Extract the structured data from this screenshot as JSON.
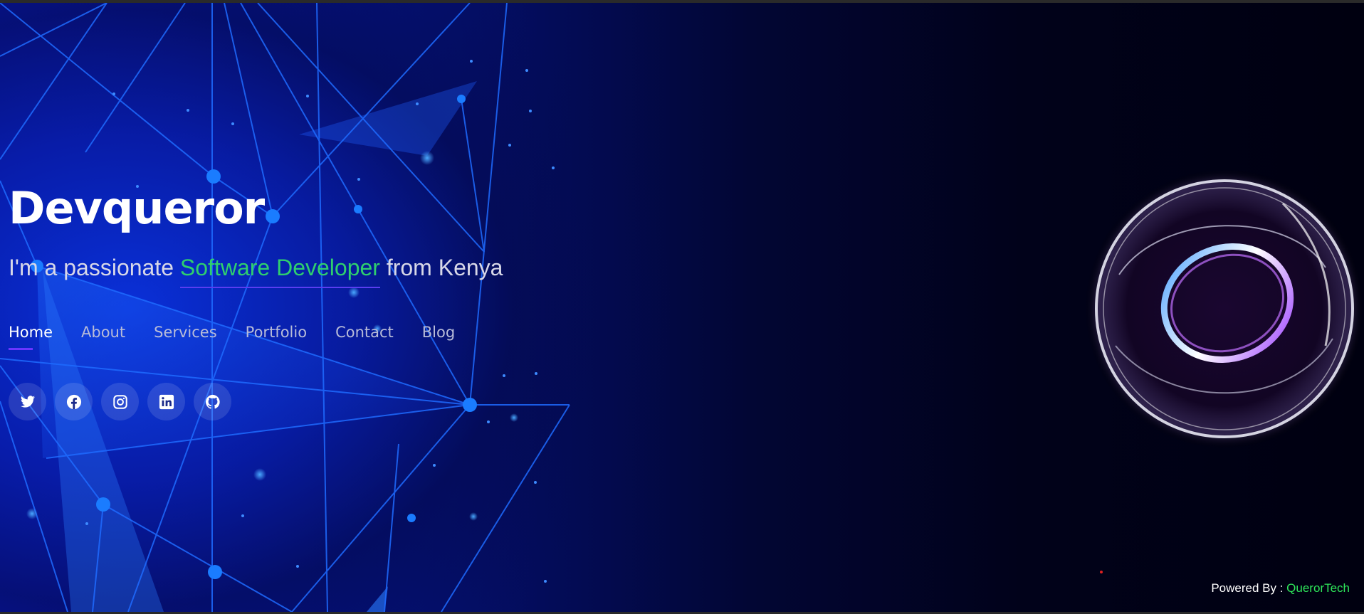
{
  "hero": {
    "title": "Devqueror",
    "subtitle_prefix": "I'm a passionate ",
    "subtitle_highlight": "Software Developer",
    "subtitle_suffix": " from Kenya"
  },
  "nav": {
    "items": [
      {
        "label": "Home",
        "active": true
      },
      {
        "label": "About"
      },
      {
        "label": "Services"
      },
      {
        "label": "Portfolio"
      },
      {
        "label": "Contact"
      },
      {
        "label": "Blog"
      }
    ]
  },
  "social": {
    "icons": [
      "twitter-icon",
      "facebook-icon",
      "instagram-icon",
      "linkedin-icon",
      "github-icon"
    ]
  },
  "footer": {
    "prefix": "Powered By : ",
    "brand": "QuerorTech"
  },
  "colors": {
    "accent_green": "#2fcf6e",
    "underline_purple": "#6a36ff",
    "brand_green": "#2ee65a"
  }
}
